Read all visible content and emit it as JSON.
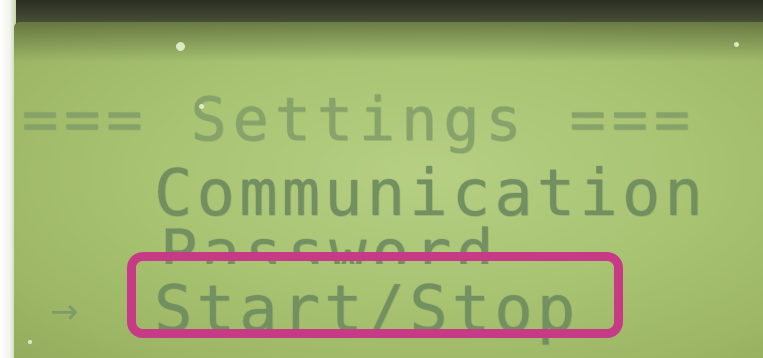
{
  "display": {
    "title_line": "=== Settings ===",
    "menu_items": [
      {
        "label": "Communication",
        "selected": false
      },
      {
        "label": "Password",
        "selected": false
      },
      {
        "label": "Start/Stop",
        "selected": true
      }
    ],
    "selection_indicator": "→"
  },
  "colors": {
    "lcd_background": "#a9c473",
    "lcd_text": "#6f8d5a",
    "highlight_box": "#c73a86",
    "bezel": "#2a2d22"
  },
  "icons": {
    "cursor": "right-arrow-icon"
  }
}
